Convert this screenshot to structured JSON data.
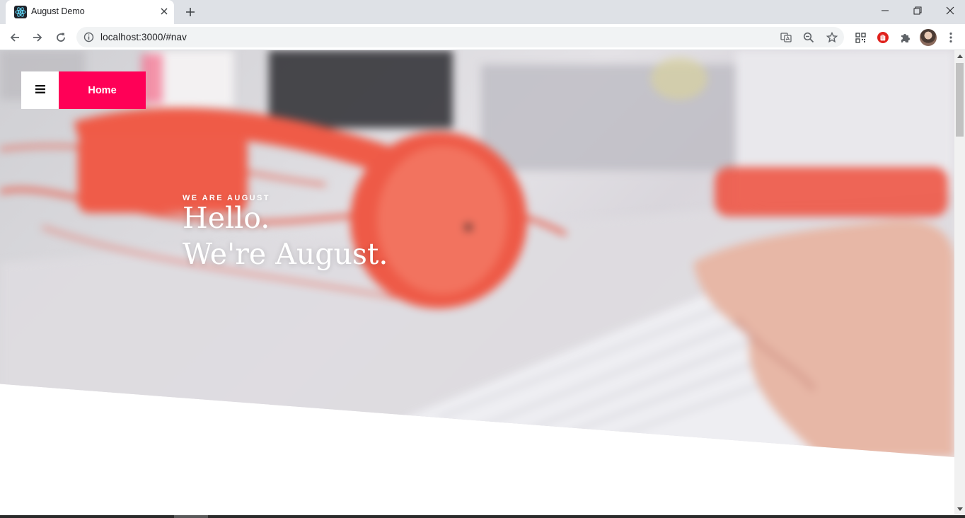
{
  "browser": {
    "tab_title": "August Demo",
    "favicon": "react-icon",
    "url": "localhost:3000/#nav",
    "icons": [
      "back-icon",
      "forward-icon",
      "reload-icon",
      "info-icon",
      "translate-icon",
      "zoom-out-icon",
      "bookmark-star-icon",
      "qr-code-icon",
      "adblock-icon",
      "extensions-puzzle-icon",
      "profile-avatar",
      "kebab-menu-icon"
    ]
  },
  "nav": {
    "menu_icon": "hamburger-icon",
    "home_label": "Home"
  },
  "hero": {
    "eyebrow": "WE ARE AUGUST",
    "title_line1": "Hello.",
    "title_line2": "We're August."
  },
  "colors": {
    "accent": "#ff0057",
    "hero_text": "#ffffff",
    "headphones": "#f0594a"
  }
}
